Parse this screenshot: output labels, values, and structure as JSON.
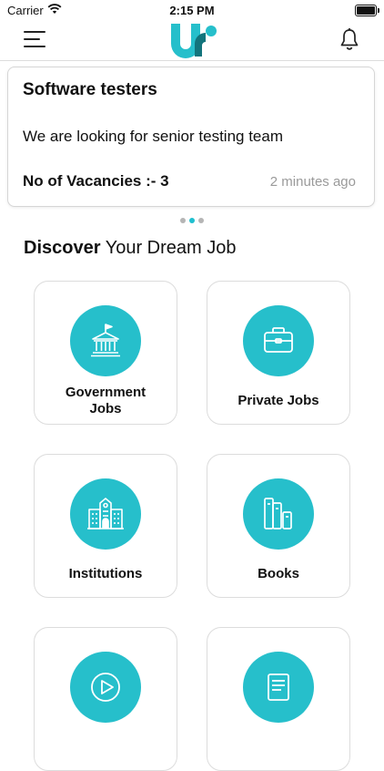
{
  "status_bar": {
    "carrier": "Carrier",
    "time": "2:15 PM"
  },
  "job_card": {
    "title": "Software testers",
    "description": "We are looking for senior testing team",
    "vacancies": "No of Vacancies :- 3",
    "posted": "2 minutes ago"
  },
  "carousel": {
    "page_count": 3,
    "active_index": 1
  },
  "section": {
    "bold": "Discover",
    "rest": " Your Dream Job"
  },
  "categories": [
    {
      "label": "Government Jobs",
      "icon": "government-building-icon"
    },
    {
      "label": "Private Jobs",
      "icon": "briefcase-icon"
    },
    {
      "label": "Institutions",
      "icon": "institution-building-icon"
    },
    {
      "label": "Books",
      "icon": "books-icon"
    },
    {
      "label": "",
      "icon": "play-video-icon"
    },
    {
      "label": "",
      "icon": "document-icon"
    }
  ],
  "colors": {
    "accent": "#26bfcb",
    "logo_dark": "#13747c",
    "muted_text": "#9a9a9a"
  }
}
